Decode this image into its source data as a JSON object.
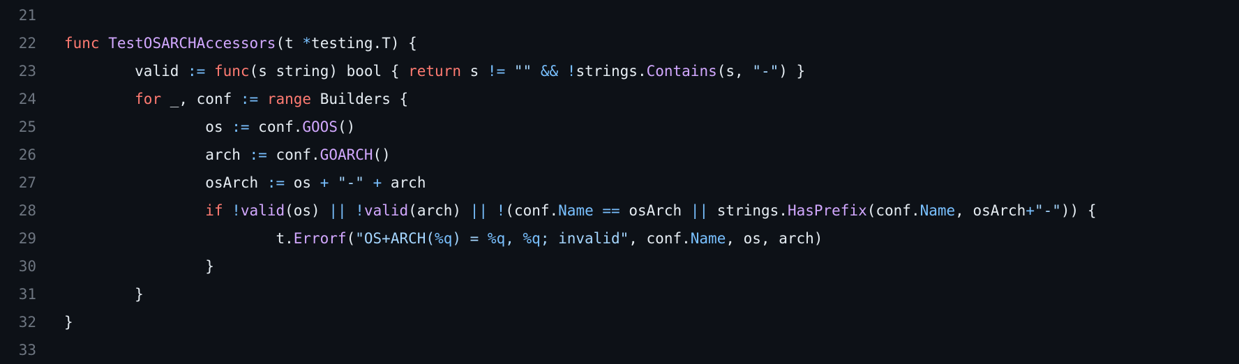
{
  "colors": {
    "background": "#0d1117",
    "line_number": "#6e7681",
    "text": "#e6edf3",
    "keyword": "#ff7b72",
    "function": "#d2a8ff",
    "operator": "#79c0ff",
    "string": "#a5d6ff"
  },
  "lines": [
    {
      "number": "21",
      "indent": 0,
      "tokens": []
    },
    {
      "number": "22",
      "indent": 0,
      "tokens": [
        {
          "t": "func",
          "k": "kw"
        },
        {
          "t": " ",
          "k": "plain"
        },
        {
          "t": "TestOSARCHAccessors",
          "k": "fn"
        },
        {
          "t": "(t ",
          "k": "plain"
        },
        {
          "t": "*",
          "k": "op"
        },
        {
          "t": "testing.T) {",
          "k": "plain"
        }
      ]
    },
    {
      "number": "23",
      "indent": 1,
      "tokens": [
        {
          "t": "valid ",
          "k": "plain"
        },
        {
          "t": ":=",
          "k": "op"
        },
        {
          "t": " ",
          "k": "plain"
        },
        {
          "t": "func",
          "k": "kw"
        },
        {
          "t": "(s string) bool { ",
          "k": "plain"
        },
        {
          "t": "return",
          "k": "kw"
        },
        {
          "t": " s ",
          "k": "plain"
        },
        {
          "t": "!=",
          "k": "op"
        },
        {
          "t": " ",
          "k": "plain"
        },
        {
          "t": "\"\"",
          "k": "str"
        },
        {
          "t": " ",
          "k": "plain"
        },
        {
          "t": "&&",
          "k": "op"
        },
        {
          "t": " ",
          "k": "plain"
        },
        {
          "t": "!",
          "k": "op"
        },
        {
          "t": "strings.",
          "k": "plain"
        },
        {
          "t": "Contains",
          "k": "fn"
        },
        {
          "t": "(s, ",
          "k": "plain"
        },
        {
          "t": "\"-\"",
          "k": "str"
        },
        {
          "t": ") }",
          "k": "plain"
        }
      ]
    },
    {
      "number": "24",
      "indent": 1,
      "tokens": [
        {
          "t": "for",
          "k": "kw"
        },
        {
          "t": " _, conf ",
          "k": "plain"
        },
        {
          "t": ":=",
          "k": "op"
        },
        {
          "t": " ",
          "k": "plain"
        },
        {
          "t": "range",
          "k": "kw"
        },
        {
          "t": " Builders {",
          "k": "plain"
        }
      ]
    },
    {
      "number": "25",
      "indent": 2,
      "tokens": [
        {
          "t": "os ",
          "k": "plain"
        },
        {
          "t": ":=",
          "k": "op"
        },
        {
          "t": " conf.",
          "k": "plain"
        },
        {
          "t": "GOOS",
          "k": "fn"
        },
        {
          "t": "()",
          "k": "plain"
        }
      ]
    },
    {
      "number": "26",
      "indent": 2,
      "tokens": [
        {
          "t": "arch ",
          "k": "plain"
        },
        {
          "t": ":=",
          "k": "op"
        },
        {
          "t": " conf.",
          "k": "plain"
        },
        {
          "t": "GOARCH",
          "k": "fn"
        },
        {
          "t": "()",
          "k": "plain"
        }
      ]
    },
    {
      "number": "27",
      "indent": 2,
      "tokens": [
        {
          "t": "osArch ",
          "k": "plain"
        },
        {
          "t": ":=",
          "k": "op"
        },
        {
          "t": " os ",
          "k": "plain"
        },
        {
          "t": "+",
          "k": "op"
        },
        {
          "t": " ",
          "k": "plain"
        },
        {
          "t": "\"-\"",
          "k": "str"
        },
        {
          "t": " ",
          "k": "plain"
        },
        {
          "t": "+",
          "k": "op"
        },
        {
          "t": " arch",
          "k": "plain"
        }
      ]
    },
    {
      "number": "28",
      "indent": 2,
      "tokens": [
        {
          "t": "if",
          "k": "kw"
        },
        {
          "t": " ",
          "k": "plain"
        },
        {
          "t": "!",
          "k": "op"
        },
        {
          "t": "valid",
          "k": "fn"
        },
        {
          "t": "(os) ",
          "k": "plain"
        },
        {
          "t": "||",
          "k": "op"
        },
        {
          "t": " ",
          "k": "plain"
        },
        {
          "t": "!",
          "k": "op"
        },
        {
          "t": "valid",
          "k": "fn"
        },
        {
          "t": "(arch) ",
          "k": "plain"
        },
        {
          "t": "||",
          "k": "op"
        },
        {
          "t": " ",
          "k": "plain"
        },
        {
          "t": "!",
          "k": "op"
        },
        {
          "t": "(conf.",
          "k": "plain"
        },
        {
          "t": "Name",
          "k": "prop"
        },
        {
          "t": " ",
          "k": "plain"
        },
        {
          "t": "==",
          "k": "op"
        },
        {
          "t": " osArch ",
          "k": "plain"
        },
        {
          "t": "||",
          "k": "op"
        },
        {
          "t": " strings.",
          "k": "plain"
        },
        {
          "t": "HasPrefix",
          "k": "fn"
        },
        {
          "t": "(conf.",
          "k": "plain"
        },
        {
          "t": "Name",
          "k": "prop"
        },
        {
          "t": ", osArch",
          "k": "plain"
        },
        {
          "t": "+",
          "k": "op"
        },
        {
          "t": "\"-\"",
          "k": "str"
        },
        {
          "t": ")) {",
          "k": "plain"
        }
      ]
    },
    {
      "number": "29",
      "indent": 3,
      "tokens": [
        {
          "t": "t.",
          "k": "plain"
        },
        {
          "t": "Errorf",
          "k": "fn"
        },
        {
          "t": "(",
          "k": "plain"
        },
        {
          "t": "\"OS+ARCH(",
          "k": "str"
        },
        {
          "t": "%q",
          "k": "op"
        },
        {
          "t": ") = ",
          "k": "str"
        },
        {
          "t": "%q",
          "k": "op"
        },
        {
          "t": ", ",
          "k": "str"
        },
        {
          "t": "%q",
          "k": "op"
        },
        {
          "t": "; invalid\"",
          "k": "str"
        },
        {
          "t": ", conf.",
          "k": "plain"
        },
        {
          "t": "Name",
          "k": "prop"
        },
        {
          "t": ", os, arch)",
          "k": "plain"
        }
      ]
    },
    {
      "number": "30",
      "indent": 2,
      "tokens": [
        {
          "t": "}",
          "k": "plain"
        }
      ]
    },
    {
      "number": "31",
      "indent": 1,
      "tokens": [
        {
          "t": "}",
          "k": "plain"
        }
      ]
    },
    {
      "number": "32",
      "indent": 0,
      "tokens": [
        {
          "t": "}",
          "k": "plain"
        }
      ]
    },
    {
      "number": "33",
      "indent": 0,
      "tokens": []
    }
  ]
}
